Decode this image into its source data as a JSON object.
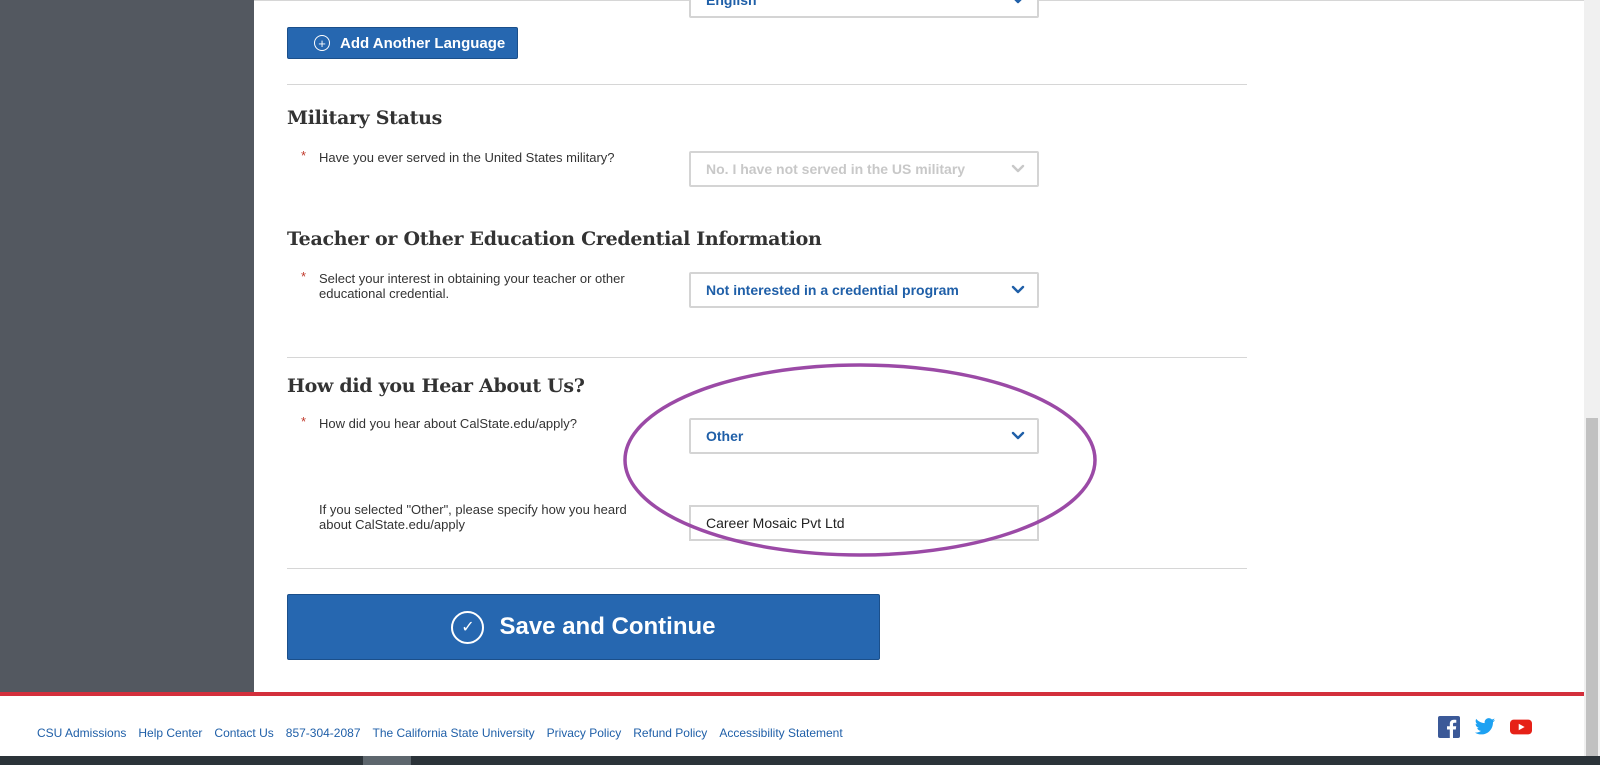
{
  "languages": {
    "current_language_value": "English",
    "add_button_label": "Add Another Language"
  },
  "military": {
    "heading": "Military Status",
    "question": "Have you ever served in the United States military?",
    "answer": "No. I have not served in the US military"
  },
  "credential": {
    "heading": "Teacher or Other Education Credential Information",
    "question": "Select your interest in obtaining your teacher or other educational credential.",
    "answer": "Not interested in a credential program"
  },
  "referral": {
    "heading": "How did you Hear About Us?",
    "question": "How did you hear about CalState.edu/apply?",
    "answer": "Other",
    "other_question": "If you selected \"Other\", please specify how you heard about CalState.edu/apply",
    "other_value": "Career Mosaic Pvt Ltd"
  },
  "required_marker": "*",
  "save_button_label": "Save and Continue",
  "footer": {
    "links": [
      "CSU Admissions",
      "Help Center",
      "Contact Us",
      "857-304-2087",
      "The California State University",
      "Privacy Policy",
      "Refund Policy",
      "Accessibility Statement"
    ],
    "social_icons": [
      "facebook-icon",
      "twitter-icon",
      "youtube-icon"
    ]
  },
  "colors": {
    "primary_blue": "#2667b0",
    "link_blue": "#1f5fa8",
    "accent_red": "#d32f3c",
    "rail_gray": "#535860",
    "annotation_purple": "#9b4aa6"
  }
}
